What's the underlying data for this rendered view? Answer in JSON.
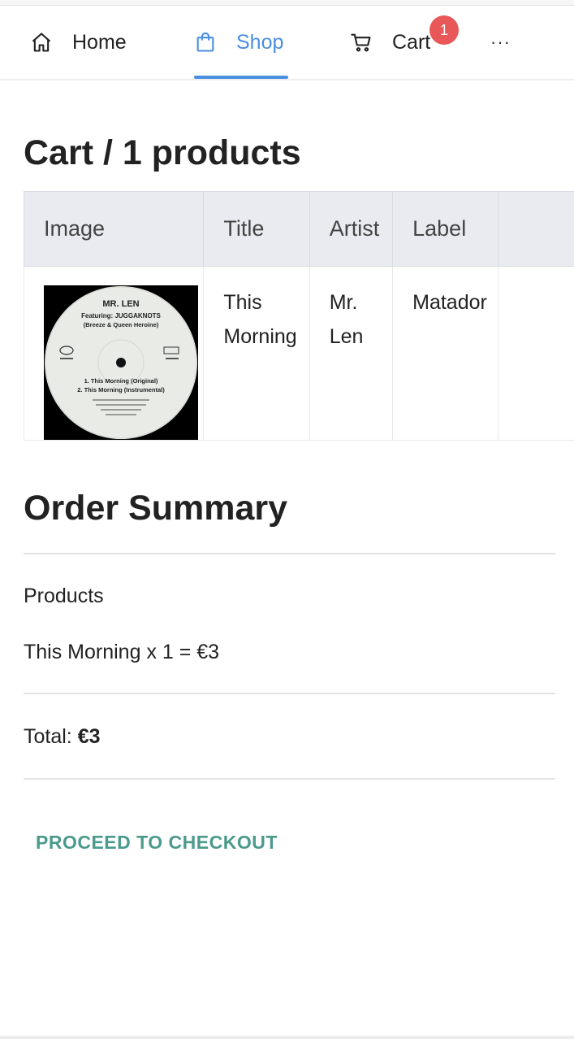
{
  "nav": {
    "home_label": "Home",
    "shop_label": "Shop",
    "cart_label": "Cart",
    "cart_badge": "1",
    "more_label": "···",
    "active": "shop",
    "accent_color": "#4a8fe0",
    "badge_color": "#e85858"
  },
  "cart": {
    "title": "Cart / 1 products",
    "columns": [
      "Image",
      "Title",
      "Artist",
      "Label"
    ],
    "rows": [
      {
        "image_icon": "vinyl-record-cover",
        "title": "This Morning",
        "artist": "Mr. Len",
        "label": "Matador",
        "cover": {
          "line1": "MR. LEN",
          "line2": "Featuring: JUGGAKNOTS",
          "line3": "(Breeze & Queen Heroine)",
          "track1": "1. This Morning (Original)",
          "track2": "2. This Morning (Instrumental)"
        }
      }
    ]
  },
  "summary": {
    "title": "Order Summary",
    "products_label": "Products",
    "line_item": "This Morning x 1 = €3",
    "total_label": "Total:",
    "total_value": "€3",
    "checkout_label": "PROCEED TO CHECKOUT",
    "checkout_color": "#4b9a8c"
  }
}
